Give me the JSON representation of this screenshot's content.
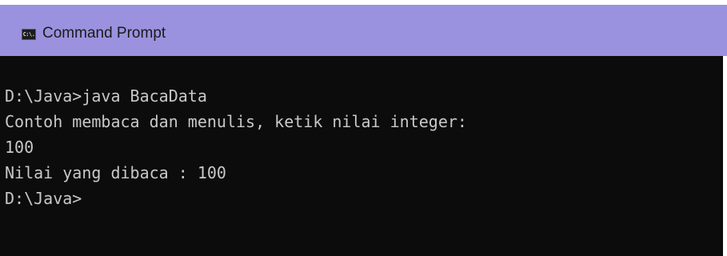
{
  "window": {
    "title": "Command Prompt",
    "icon": "cmd-icon",
    "icon_text": "C:\\."
  },
  "console": {
    "lines": [
      "D:\\Java>java BacaData",
      "Contoh membaca dan menulis, ketik nilai integer:",
      "100",
      "Nilai yang dibaca : 100",
      "D:\\Java>"
    ]
  },
  "colors": {
    "titlebar": "#9a92de",
    "console_bg": "#0c0c0c",
    "console_text": "#c8c8c8"
  }
}
